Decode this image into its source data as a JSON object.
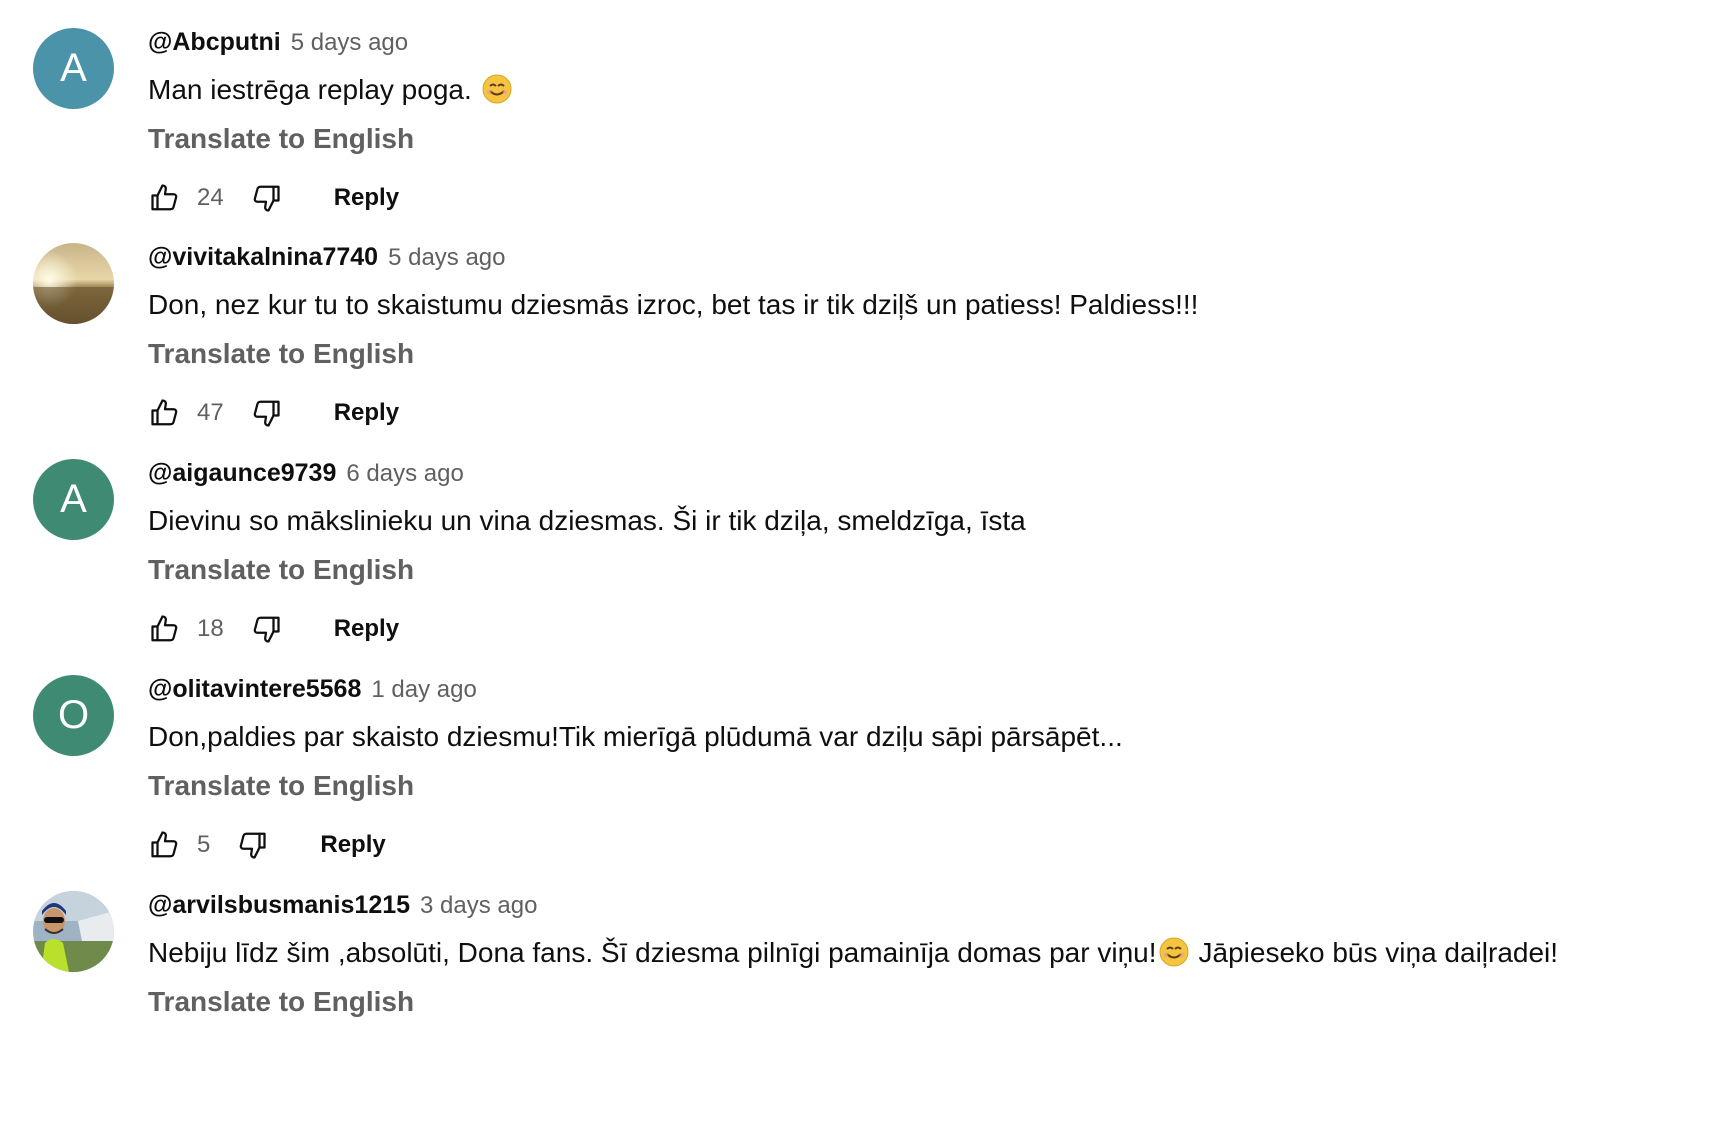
{
  "comments": [
    {
      "author": "@Abcputni",
      "time": "5 days ago",
      "text": "Man iestrēga replay poga.",
      "has_emoji": true,
      "translate": "Translate to English",
      "likes": "24",
      "reply": "Reply",
      "avatar": {
        "type": "letter",
        "letter": "A",
        "color": "#4a93a8"
      }
    },
    {
      "author": "@vivitakalnina7740",
      "time": "5 days ago",
      "text": "Don, nez kur tu to skaistumu dziesmās izroc, bet tas ir tik dziļš un patiess! Paldiess!!!",
      "translate": "Translate to English",
      "likes": "47",
      "reply": "Reply",
      "avatar": {
        "type": "photo",
        "description": "sunset-field"
      }
    },
    {
      "author": "@aigaunce9739",
      "time": "6 days ago",
      "text": "Dievinu so mākslinieku un vina dziesmas. Ši ir tik dziļa, smeldzīga, īsta",
      "translate": "Translate to English",
      "likes": "18",
      "reply": "Reply",
      "avatar": {
        "type": "letter",
        "letter": "A",
        "color": "#3f8a73"
      }
    },
    {
      "author": "@olitavintere5568",
      "time": "1 day ago",
      "text": "Don,paldies par skaisto dziesmu!Tik mierīgā plūdumā var dziļu sāpi pārsāpēt...",
      "translate": "Translate to English",
      "likes": "5",
      "reply": "Reply",
      "avatar": {
        "type": "letter",
        "letter": "O",
        "color": "#3f8a73"
      }
    },
    {
      "author": "@arvilsbusmanis1215",
      "time": "3 days ago",
      "text_before": "Nebiju līdz šim ,absolūti, Dona fans. Šī dziesma pilnīgi pamainīja domas par viņu!",
      "text_after": "Jāpieseko būs viņa daiļradei!",
      "translate": "Translate to English",
      "avatar": {
        "type": "photo",
        "description": "man-sunglasses-helmet"
      }
    }
  ],
  "colors": {
    "text": "#0f0f0f",
    "secondary": "#606060",
    "background": "#ffffff"
  },
  "icons": [
    "thumb-up-icon",
    "thumb-down-icon",
    "smile-emoji-icon"
  ]
}
